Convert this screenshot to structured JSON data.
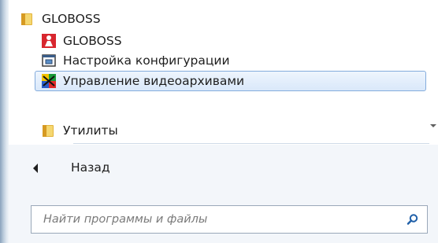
{
  "start_menu": {
    "programs": {
      "folder": {
        "label": "GLOBOSS",
        "icon": "folder-icon"
      },
      "items": [
        {
          "label": "GLOBOSS",
          "icon": "globoss-app-icon"
        },
        {
          "label": "Настройка конфигурации",
          "icon": "configuration-window-icon"
        },
        {
          "label": "Управление видеоархивами",
          "icon": "video-archive-icon",
          "selected": true
        },
        {
          "label": "Утилиты",
          "icon": "folder-icon"
        }
      ]
    },
    "back": {
      "label": "Назад",
      "icon": "back-arrow-icon"
    },
    "search": {
      "placeholder": "Найти программы и файлы",
      "icon": "search-icon"
    }
  },
  "colors": {
    "selection_border": "#84acdd",
    "selection_fill": "#d9e8fa",
    "lower_panel": "#f3f6fa",
    "search_icon": "#1f5fa8"
  }
}
